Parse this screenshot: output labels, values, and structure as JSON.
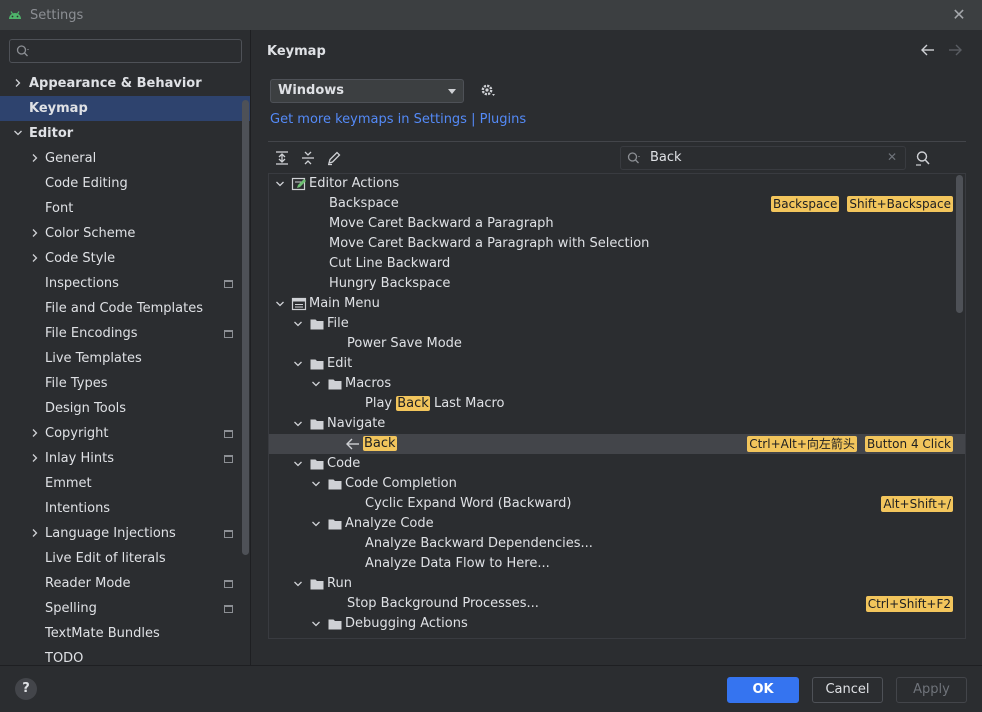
{
  "window": {
    "title": "Settings",
    "close_icon": "close-icon"
  },
  "left": {
    "search_placeholder": "",
    "items": [
      {
        "label": "Appearance & Behavior",
        "level": 0,
        "chevron": "right",
        "bold": true
      },
      {
        "label": "Keymap",
        "level": 0,
        "chevron": "",
        "bold": true,
        "selected": true
      },
      {
        "label": "Editor",
        "level": 0,
        "chevron": "down",
        "bold": true
      },
      {
        "label": "General",
        "level": 1,
        "chevron": "right"
      },
      {
        "label": "Code Editing",
        "level": 1,
        "chevron": ""
      },
      {
        "label": "Font",
        "level": 1,
        "chevron": ""
      },
      {
        "label": "Color Scheme",
        "level": 1,
        "chevron": "right"
      },
      {
        "label": "Code Style",
        "level": 1,
        "chevron": "right"
      },
      {
        "label": "Inspections",
        "level": 1,
        "chevron": "",
        "project": true
      },
      {
        "label": "File and Code Templates",
        "level": 1,
        "chevron": ""
      },
      {
        "label": "File Encodings",
        "level": 1,
        "chevron": "",
        "project": true
      },
      {
        "label": "Live Templates",
        "level": 1,
        "chevron": ""
      },
      {
        "label": "File Types",
        "level": 1,
        "chevron": ""
      },
      {
        "label": "Design Tools",
        "level": 1,
        "chevron": ""
      },
      {
        "label": "Copyright",
        "level": 1,
        "chevron": "right",
        "project": true
      },
      {
        "label": "Inlay Hints",
        "level": 1,
        "chevron": "right",
        "project": true
      },
      {
        "label": "Emmet",
        "level": 1,
        "chevron": ""
      },
      {
        "label": "Intentions",
        "level": 1,
        "chevron": ""
      },
      {
        "label": "Language Injections",
        "level": 1,
        "chevron": "right",
        "project": true
      },
      {
        "label": "Live Edit of literals",
        "level": 1,
        "chevron": ""
      },
      {
        "label": "Reader Mode",
        "level": 1,
        "chevron": "",
        "project": true
      },
      {
        "label": "Spelling",
        "level": 1,
        "chevron": "",
        "project": true
      },
      {
        "label": "TextMate Bundles",
        "level": 1,
        "chevron": ""
      },
      {
        "label": "TODO",
        "level": 1,
        "chevron": ""
      }
    ]
  },
  "keymap": {
    "title": "Keymap",
    "selected_keymap": "Windows",
    "get_more_prefix": "Get more keymaps in Settings | ",
    "get_more_link": "Plugins",
    "search_value": "Back",
    "tree": [
      {
        "label": "Editor Actions",
        "level": 0,
        "expand": "down",
        "icon": "editor-actions-icon"
      },
      {
        "label": "Backspace",
        "level": 2,
        "shortcuts": [
          "Backspace",
          "Shift+Backspace"
        ]
      },
      {
        "label": "Move Caret Backward a Paragraph",
        "level": 2
      },
      {
        "label": "Move Caret Backward a Paragraph with Selection",
        "level": 2
      },
      {
        "label": "Cut Line Backward",
        "level": 2
      },
      {
        "label": "Hungry Backspace",
        "level": 2
      },
      {
        "label": "Main Menu",
        "level": 0,
        "expand": "down",
        "icon": "main-menu-icon"
      },
      {
        "label": "File",
        "level": 1,
        "expand": "down",
        "icon": "folder-icon"
      },
      {
        "label": "Power Save Mode",
        "level": 3
      },
      {
        "label": "Edit",
        "level": 1,
        "expand": "down",
        "icon": "folder-icon"
      },
      {
        "label": "Macros",
        "level": 2,
        "expand": "down",
        "icon": "folder-icon"
      },
      {
        "label_pre": "Play ",
        "label_hl": "Back",
        "label_post": " Last Macro",
        "level": 4
      },
      {
        "label": "Navigate",
        "level": 1,
        "expand": "down",
        "icon": "folder-icon"
      },
      {
        "label_hl": "Back",
        "level": 3,
        "icon": "back-arrow-icon",
        "selected": true,
        "shortcuts": [
          "Ctrl+Alt+向左箭头",
          "Button 4 Click"
        ]
      },
      {
        "label": "Code",
        "level": 1,
        "expand": "down",
        "icon": "folder-icon"
      },
      {
        "label": "Code Completion",
        "level": 2,
        "expand": "down",
        "icon": "folder-icon"
      },
      {
        "label": "Cyclic Expand Word (Backward)",
        "level": 4,
        "shortcuts": [
          "Alt+Shift+/"
        ]
      },
      {
        "label": "Analyze Code",
        "level": 2,
        "expand": "down",
        "icon": "folder-icon"
      },
      {
        "label": "Analyze Backward Dependencies...",
        "level": 4
      },
      {
        "label": "Analyze Data Flow to Here...",
        "level": 4
      },
      {
        "label": "Run",
        "level": 1,
        "expand": "down",
        "icon": "folder-icon"
      },
      {
        "label": "Stop Background Processes...",
        "level": 3,
        "shortcuts": [
          "Ctrl+Shift+F2"
        ]
      },
      {
        "label": "Debugging Actions",
        "level": 2,
        "expand": "down",
        "icon": "folder-icon"
      }
    ]
  },
  "footer": {
    "help": "?",
    "ok": "OK",
    "cancel": "Cancel",
    "apply": "Apply"
  },
  "colors": {
    "accent": "#3574f0",
    "highlight": "#f2c55c",
    "link": "#548af7",
    "selection": "#2e436e"
  }
}
